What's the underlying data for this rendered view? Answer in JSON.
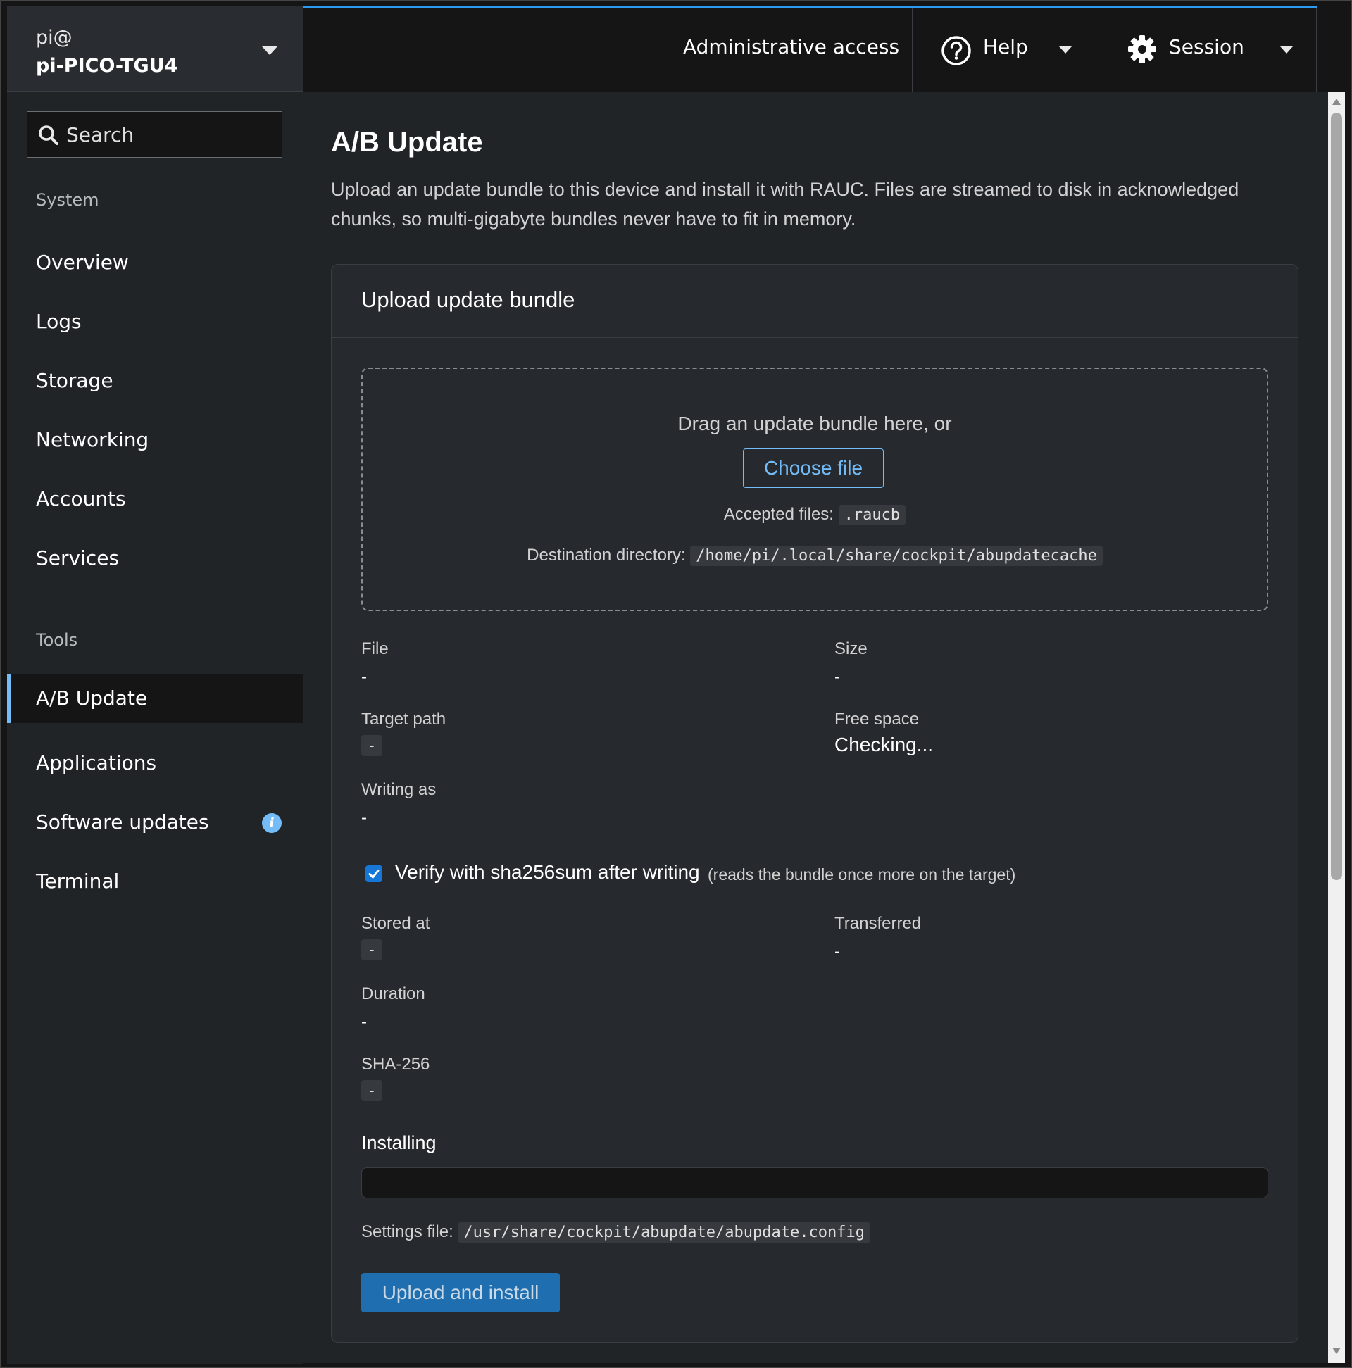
{
  "host": {
    "user": "pi@",
    "name": "pi-PICO-TGU4"
  },
  "search": {
    "placeholder": "Search"
  },
  "sidebar": {
    "system_heading": "System",
    "system_items": [
      "Overview",
      "Logs",
      "Storage",
      "Networking",
      "Accounts",
      "Services"
    ],
    "tools_heading": "Tools",
    "tools_items": [
      "A/B Update",
      "Applications",
      "Software updates",
      "Terminal"
    ],
    "active_item": "A/B Update"
  },
  "topbar": {
    "admin_access": "Administrative access",
    "help": "Help",
    "session": "Session",
    "accent_color": "#2b9af3"
  },
  "page": {
    "title": "A/B Update",
    "description": "Upload an update bundle to this device and install it with RAUC. Files are streamed to disk in acknowledged chunks, so multi-gigabyte bundles never have to fit in memory."
  },
  "card": {
    "title": "Upload update bundle",
    "dropzone": {
      "prompt": "Drag an update bundle here, or",
      "choose_file": "Choose file",
      "accepted_label": "Accepted files:",
      "accepted_value": ".raucb",
      "destination_label": "Destination directory:",
      "destination_value": "/home/pi/.local/share/cockpit/abupdatecache"
    },
    "fields": {
      "file": {
        "label": "File",
        "value": "-"
      },
      "size": {
        "label": "Size",
        "value": "-"
      },
      "target_path": {
        "label": "Target path",
        "value": "-"
      },
      "free_space": {
        "label": "Free space",
        "value": "Checking..."
      },
      "writing_as": {
        "label": "Writing as",
        "value": "-"
      },
      "stored_at": {
        "label": "Stored at",
        "value": "-"
      },
      "transferred": {
        "label": "Transferred",
        "value": "-"
      },
      "duration": {
        "label": "Duration",
        "value": "-"
      },
      "sha256": {
        "label": "SHA-256",
        "value": "-"
      }
    },
    "verify": {
      "checked": true,
      "label": "Verify with sha256sum after writing",
      "note": "(reads the bundle once more on the target)"
    },
    "installing": {
      "title": "Installing",
      "progress_percent": 0
    },
    "settings": {
      "label": "Settings file:",
      "value": "/usr/share/cockpit/abupdate/abupdate.config"
    },
    "upload_button": "Upload and install"
  }
}
